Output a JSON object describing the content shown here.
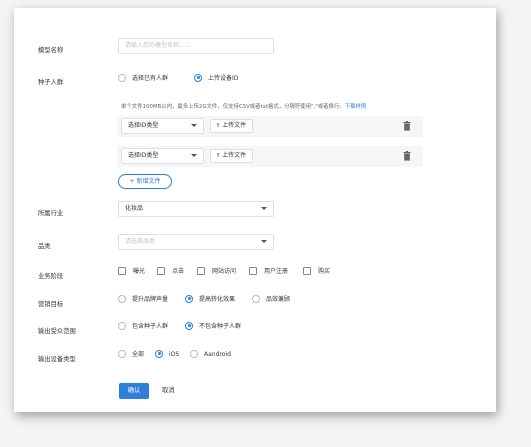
{
  "form": {
    "model_name": {
      "label": "模型名称",
      "placeholder": "请输入您的模型名称......"
    },
    "seed": {
      "label": "种子人群",
      "options": [
        "选择已有人群",
        "上传设备ID"
      ],
      "selected": "上传设备ID",
      "hint_text": "单个文件100MB以内，最多上传2G文件，仅支持CSV或者txt格式，分隔符使用\",\"或者换行。",
      "hint_link": "下载样例",
      "rows": [
        {
          "type_value": "选择ID类型",
          "upload_label": "上传文件"
        },
        {
          "type_value": "选择ID类型",
          "upload_label": "上传文件"
        }
      ],
      "add_file": "新增文件"
    },
    "industry": {
      "label": "所属行业",
      "value": "化妆品"
    },
    "category": {
      "label": "品类",
      "placeholder": "请选择品类"
    },
    "stage": {
      "label": "业务阶段",
      "options": [
        "曝光",
        "点击",
        "网站访问",
        "用户注册",
        "购买"
      ]
    },
    "goal": {
      "label": "营销目标",
      "options": [
        "提升品牌声量",
        "提高转化效果",
        "品效兼顾"
      ],
      "selected": "提高转化效果"
    },
    "audience": {
      "label": "输出受众范围",
      "options": [
        "包含种子人群",
        "不包含种子人群"
      ],
      "selected": "不包含种子人群"
    },
    "device": {
      "label": "输出设备类型",
      "options": [
        "全部",
        "iOS",
        "Aandroid"
      ],
      "selected": "iOS"
    },
    "actions": {
      "confirm": "确认",
      "cancel": "取消"
    }
  },
  "colors": {
    "accent": "#2f7ed8",
    "border": "#dcdfe6",
    "shadow": "#7f7f7f"
  }
}
